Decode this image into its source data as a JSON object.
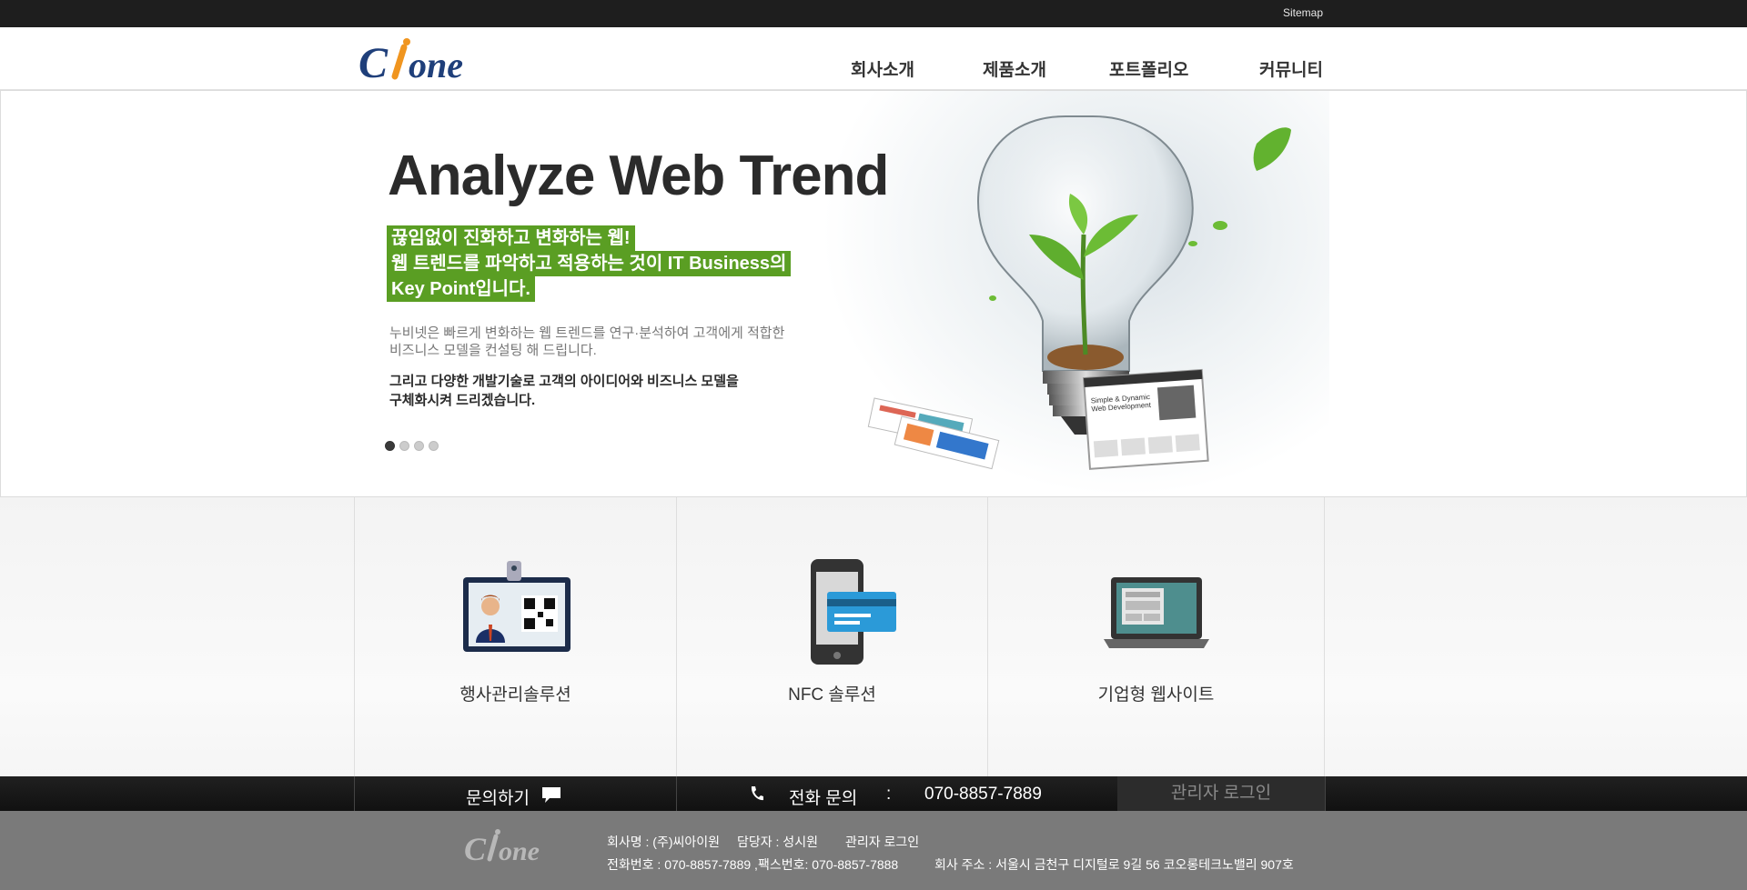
{
  "topbar": {
    "sitemap": "Sitemap"
  },
  "header": {
    "logo_text": "Clone",
    "nav": [
      "회사소개",
      "제품소개",
      "포트폴리오",
      "커뮤니티"
    ]
  },
  "hero": {
    "title": "Analyze Web Trend",
    "highlight": [
      "끊임없이 진화하고 변화하는 웹!",
      "웹 트렌드를 파악하고 적용하는 것이 IT Business의",
      "Key Point입니다."
    ],
    "body_gray": [
      "누비넷은 빠르게 변화하는 웹 트렌드를 연구·분석하여 고객에게 적합한",
      "비즈니스 모델을 컨설팅 해 드립니다."
    ],
    "body_dark": [
      "그리고 다양한 개발기술로 고객의 아이디어와 비즈니스 모델을",
      "구체화시켜 드리겠습니다."
    ],
    "slide_count": 4,
    "active_slide": 1
  },
  "services": [
    {
      "label": "행사관리솔루션",
      "icon": "id-badge-icon"
    },
    {
      "label": "NFC 솔루션",
      "icon": "phone-card-icon"
    },
    {
      "label": "기업형 웹사이트",
      "icon": "laptop-icon"
    }
  ],
  "bottombar": {
    "inquiry": "문의하기",
    "phone_label": "전화 문의",
    "colon": ":",
    "phone": "070-8857-7889",
    "admin_login": "관리자 로그인"
  },
  "footer": {
    "logo_text": "Clone",
    "line1": {
      "company": "회사명 : (주)씨아이원",
      "manager": "담당자 : 성시원",
      "admin": "관리자 로그인"
    },
    "line2": {
      "phone_fax": "전화번호 : 070-8857-7889 ,팩스번호: 070-8857-7888",
      "address": "회사 주소 : 서울시 금천구 디지털로 9길 56 코오롱테크노밸리 907호"
    }
  },
  "colors": {
    "accent_green": "#5a9e23",
    "logo_blue": "#1f3f7a",
    "logo_orange": "#f0951f",
    "topbar": "#1e1e1e",
    "footer": "#7a7a7a"
  }
}
